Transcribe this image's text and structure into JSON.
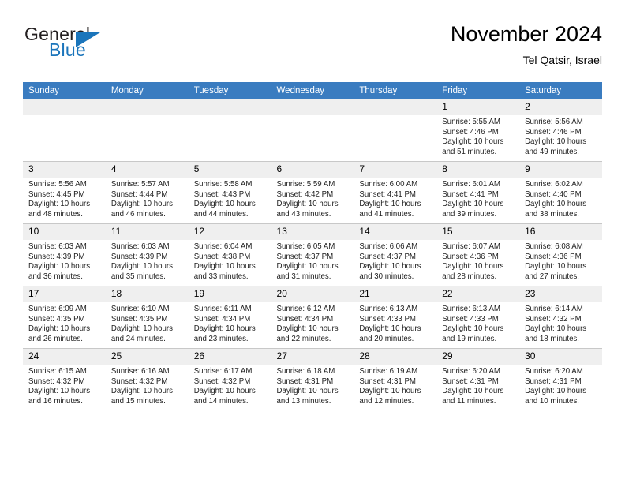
{
  "brand": {
    "name_top": "General",
    "name_bottom": "Blue",
    "accent_color": "#1b75bb"
  },
  "header": {
    "title": "November 2024",
    "subtitle": "Tel Qatsir, Israel",
    "header_bg": "#3a7cc0",
    "daynum_bg": "#efefef"
  },
  "weekday_headers": [
    "Sunday",
    "Monday",
    "Tuesday",
    "Wednesday",
    "Thursday",
    "Friday",
    "Saturday"
  ],
  "labels": {
    "sunrise_prefix": "Sunrise:",
    "sunset_prefix": "Sunset:",
    "daylight_prefix": "Daylight:"
  },
  "weeks": [
    [
      {
        "day": "",
        "empty": true
      },
      {
        "day": "",
        "empty": true
      },
      {
        "day": "",
        "empty": true
      },
      {
        "day": "",
        "empty": true
      },
      {
        "day": "",
        "empty": true
      },
      {
        "day": "1",
        "sunrise": "Sunrise: 5:55 AM",
        "sunset": "Sunset: 4:46 PM",
        "daylight": "Daylight: 10 hours and 51 minutes."
      },
      {
        "day": "2",
        "sunrise": "Sunrise: 5:56 AM",
        "sunset": "Sunset: 4:46 PM",
        "daylight": "Daylight: 10 hours and 49 minutes."
      }
    ],
    [
      {
        "day": "3",
        "sunrise": "Sunrise: 5:56 AM",
        "sunset": "Sunset: 4:45 PM",
        "daylight": "Daylight: 10 hours and 48 minutes."
      },
      {
        "day": "4",
        "sunrise": "Sunrise: 5:57 AM",
        "sunset": "Sunset: 4:44 PM",
        "daylight": "Daylight: 10 hours and 46 minutes."
      },
      {
        "day": "5",
        "sunrise": "Sunrise: 5:58 AM",
        "sunset": "Sunset: 4:43 PM",
        "daylight": "Daylight: 10 hours and 44 minutes."
      },
      {
        "day": "6",
        "sunrise": "Sunrise: 5:59 AM",
        "sunset": "Sunset: 4:42 PM",
        "daylight": "Daylight: 10 hours and 43 minutes."
      },
      {
        "day": "7",
        "sunrise": "Sunrise: 6:00 AM",
        "sunset": "Sunset: 4:41 PM",
        "daylight": "Daylight: 10 hours and 41 minutes."
      },
      {
        "day": "8",
        "sunrise": "Sunrise: 6:01 AM",
        "sunset": "Sunset: 4:41 PM",
        "daylight": "Daylight: 10 hours and 39 minutes."
      },
      {
        "day": "9",
        "sunrise": "Sunrise: 6:02 AM",
        "sunset": "Sunset: 4:40 PM",
        "daylight": "Daylight: 10 hours and 38 minutes."
      }
    ],
    [
      {
        "day": "10",
        "sunrise": "Sunrise: 6:03 AM",
        "sunset": "Sunset: 4:39 PM",
        "daylight": "Daylight: 10 hours and 36 minutes."
      },
      {
        "day": "11",
        "sunrise": "Sunrise: 6:03 AM",
        "sunset": "Sunset: 4:39 PM",
        "daylight": "Daylight: 10 hours and 35 minutes."
      },
      {
        "day": "12",
        "sunrise": "Sunrise: 6:04 AM",
        "sunset": "Sunset: 4:38 PM",
        "daylight": "Daylight: 10 hours and 33 minutes."
      },
      {
        "day": "13",
        "sunrise": "Sunrise: 6:05 AM",
        "sunset": "Sunset: 4:37 PM",
        "daylight": "Daylight: 10 hours and 31 minutes."
      },
      {
        "day": "14",
        "sunrise": "Sunrise: 6:06 AM",
        "sunset": "Sunset: 4:37 PM",
        "daylight": "Daylight: 10 hours and 30 minutes."
      },
      {
        "day": "15",
        "sunrise": "Sunrise: 6:07 AM",
        "sunset": "Sunset: 4:36 PM",
        "daylight": "Daylight: 10 hours and 28 minutes."
      },
      {
        "day": "16",
        "sunrise": "Sunrise: 6:08 AM",
        "sunset": "Sunset: 4:36 PM",
        "daylight": "Daylight: 10 hours and 27 minutes."
      }
    ],
    [
      {
        "day": "17",
        "sunrise": "Sunrise: 6:09 AM",
        "sunset": "Sunset: 4:35 PM",
        "daylight": "Daylight: 10 hours and 26 minutes."
      },
      {
        "day": "18",
        "sunrise": "Sunrise: 6:10 AM",
        "sunset": "Sunset: 4:35 PM",
        "daylight": "Daylight: 10 hours and 24 minutes."
      },
      {
        "day": "19",
        "sunrise": "Sunrise: 6:11 AM",
        "sunset": "Sunset: 4:34 PM",
        "daylight": "Daylight: 10 hours and 23 minutes."
      },
      {
        "day": "20",
        "sunrise": "Sunrise: 6:12 AM",
        "sunset": "Sunset: 4:34 PM",
        "daylight": "Daylight: 10 hours and 22 minutes."
      },
      {
        "day": "21",
        "sunrise": "Sunrise: 6:13 AM",
        "sunset": "Sunset: 4:33 PM",
        "daylight": "Daylight: 10 hours and 20 minutes."
      },
      {
        "day": "22",
        "sunrise": "Sunrise: 6:13 AM",
        "sunset": "Sunset: 4:33 PM",
        "daylight": "Daylight: 10 hours and 19 minutes."
      },
      {
        "day": "23",
        "sunrise": "Sunrise: 6:14 AM",
        "sunset": "Sunset: 4:32 PM",
        "daylight": "Daylight: 10 hours and 18 minutes."
      }
    ],
    [
      {
        "day": "24",
        "sunrise": "Sunrise: 6:15 AM",
        "sunset": "Sunset: 4:32 PM",
        "daylight": "Daylight: 10 hours and 16 minutes."
      },
      {
        "day": "25",
        "sunrise": "Sunrise: 6:16 AM",
        "sunset": "Sunset: 4:32 PM",
        "daylight": "Daylight: 10 hours and 15 minutes."
      },
      {
        "day": "26",
        "sunrise": "Sunrise: 6:17 AM",
        "sunset": "Sunset: 4:32 PM",
        "daylight": "Daylight: 10 hours and 14 minutes."
      },
      {
        "day": "27",
        "sunrise": "Sunrise: 6:18 AM",
        "sunset": "Sunset: 4:31 PM",
        "daylight": "Daylight: 10 hours and 13 minutes."
      },
      {
        "day": "28",
        "sunrise": "Sunrise: 6:19 AM",
        "sunset": "Sunset: 4:31 PM",
        "daylight": "Daylight: 10 hours and 12 minutes."
      },
      {
        "day": "29",
        "sunrise": "Sunrise: 6:20 AM",
        "sunset": "Sunset: 4:31 PM",
        "daylight": "Daylight: 10 hours and 11 minutes."
      },
      {
        "day": "30",
        "sunrise": "Sunrise: 6:20 AM",
        "sunset": "Sunset: 4:31 PM",
        "daylight": "Daylight: 10 hours and 10 minutes."
      }
    ]
  ]
}
